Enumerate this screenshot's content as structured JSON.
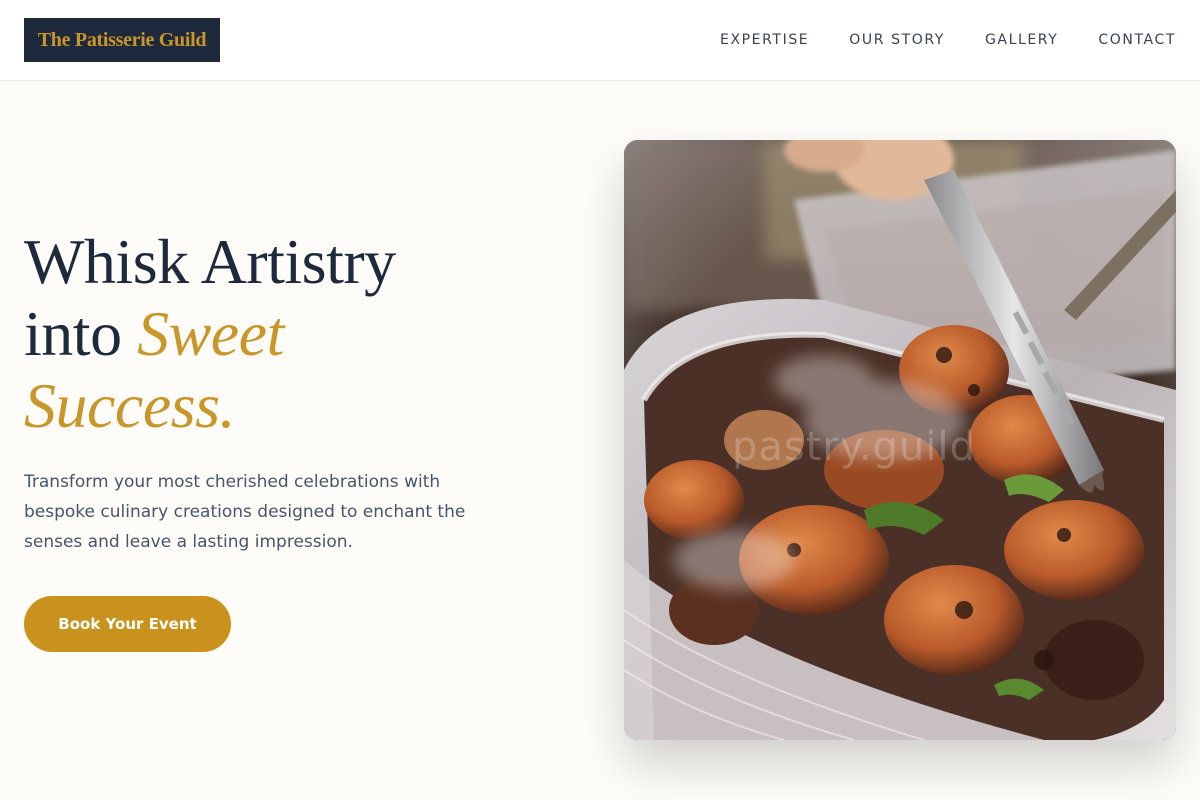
{
  "header": {
    "logo_text": "The Patisserie Guild",
    "nav": [
      {
        "label": "EXPERTISE"
      },
      {
        "label": "OUR STORY"
      },
      {
        "label": "GALLERY"
      },
      {
        "label": "CONTACT"
      }
    ]
  },
  "hero": {
    "title_line1": "Whisk Artistry",
    "title_line2_plain": "into ",
    "title_line2_accent": "Sweet",
    "title_line3_accent": "Success.",
    "description": "Transform your most cherished celebrations with bespoke culinary creations designed to enchant the senses and leave a lasting impression.",
    "cta_label": "Book Your Event",
    "image_watermark": "pastry.guild"
  },
  "colors": {
    "navy": "#1e293b",
    "gold": "#c9962a",
    "button_gold": "#c8921c",
    "background": "#fdfcf8"
  }
}
